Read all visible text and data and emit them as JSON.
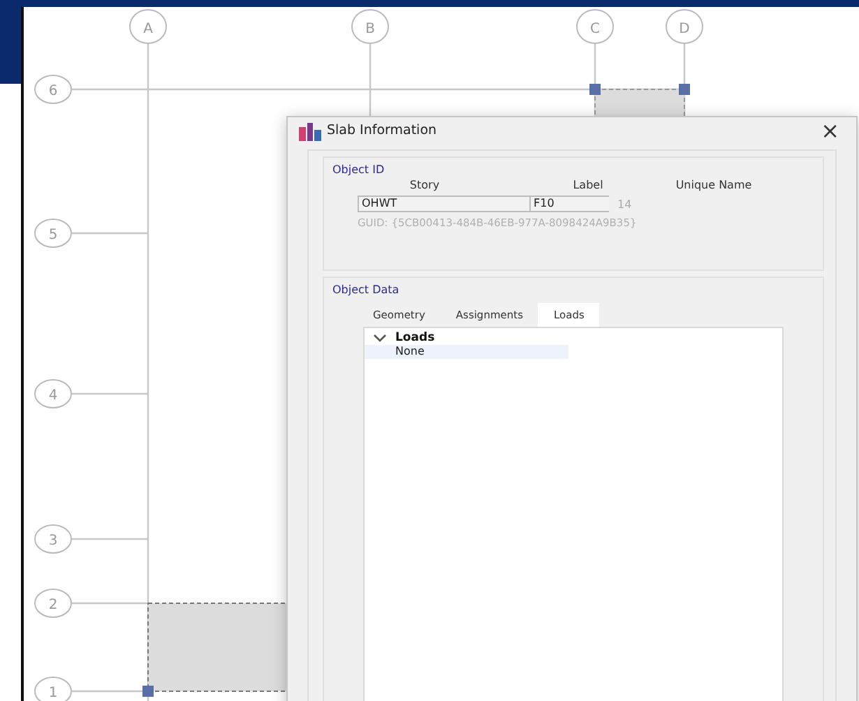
{
  "grid": {
    "columns": [
      {
        "label": "A"
      },
      {
        "label": "B"
      },
      {
        "label": "C"
      },
      {
        "label": "D"
      }
    ],
    "rows": [
      {
        "label": "6"
      },
      {
        "label": "5"
      },
      {
        "label": "4"
      },
      {
        "label": "3"
      },
      {
        "label": "2"
      },
      {
        "label": "1"
      }
    ]
  },
  "dialog": {
    "title": "Slab Information",
    "close": "×",
    "object_id": {
      "legend": "Object ID",
      "headers": [
        "Story",
        "Label",
        "Unique Name"
      ],
      "story": "OHWT",
      "label": "F10",
      "unique_name": "14",
      "guid": "GUID:  {5CB00413-484B-46EB-977A-8098424A9B35}"
    },
    "object_data": {
      "legend": "Object Data",
      "tabs": [
        {
          "label": "Geometry",
          "selected": false
        },
        {
          "label": "Assignments",
          "selected": false
        },
        {
          "label": "Loads",
          "selected": true
        }
      ],
      "tree": [
        {
          "label": "Loads",
          "expanded": true,
          "children": [
            {
              "label": "None"
            }
          ]
        }
      ]
    }
  }
}
